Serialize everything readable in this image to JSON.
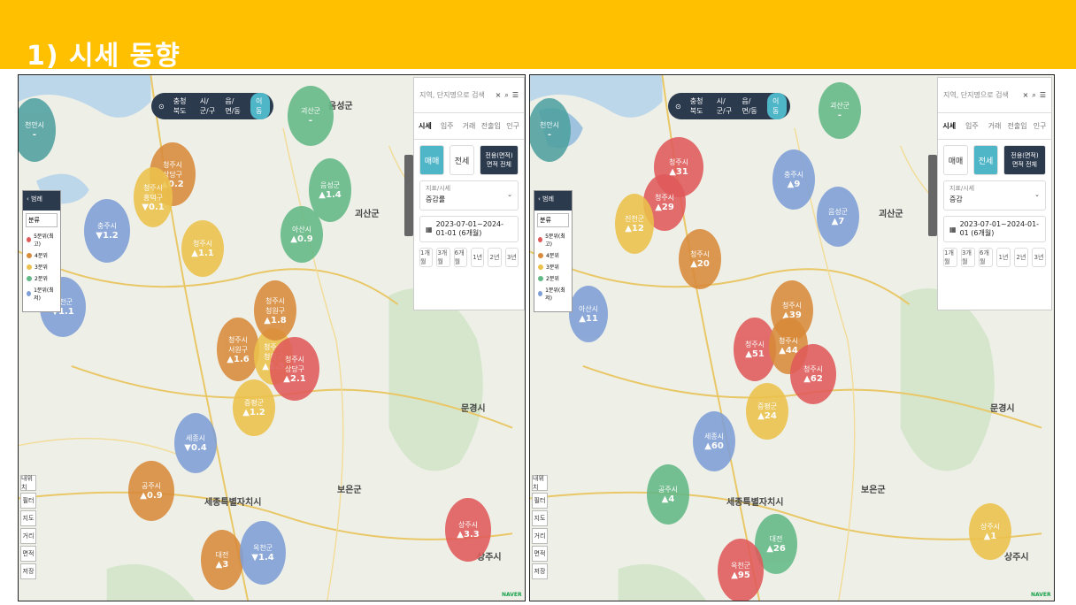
{
  "header": {
    "title": "1) 시세 동향"
  },
  "colors": {
    "header_bg": "#ffc000",
    "red": "#e05a5a",
    "orange": "#d98a3a",
    "yellow": "#ecc24c",
    "green": "#63b986",
    "blue": "#7f9fd6",
    "navy": "#2c3a4e",
    "teal": "#4fb6c8"
  },
  "regions": {
    "goesan": "괴산군",
    "boeun": "보은군",
    "sejong": "세종특별자치시",
    "mungyeong": "문경시",
    "sangju": "상주시",
    "eumseong": "음성군"
  },
  "topbar": {
    "province": "충청북도",
    "city": "시/군/구",
    "town": "읍/면/동",
    "go": "이동"
  },
  "legend": {
    "back_icon": "chevron-left-icon",
    "title": "범례",
    "select": "분류",
    "items": [
      {
        "label": "5분위(최고)",
        "color": "#e05a5a"
      },
      {
        "label": "4분위",
        "color": "#d98a3a"
      },
      {
        "label": "3분위",
        "color": "#ecc24c"
      },
      {
        "label": "2분위",
        "color": "#63b986"
      },
      {
        "label": "1분위(최저)",
        "color": "#7f9fd6"
      }
    ]
  },
  "side_left": {
    "search_placeholder": "지역, 단지명으로 검색",
    "tabs": [
      "시세",
      "입주",
      "거래",
      "전출입",
      "인구"
    ],
    "trade": "매매",
    "rent": "전세",
    "area_top": "전용(면적)",
    "area": "면적 전체",
    "stat_label": "지표/시세",
    "stat_value": "증감률",
    "date": "2023-07-01~2024-01-01 (6개월)",
    "periods": [
      "1개월",
      "3개월",
      "6개월",
      "1년",
      "2년",
      "3년"
    ]
  },
  "side_right": {
    "search_placeholder": "지역, 단지명으로 검색",
    "tabs": [
      "시세",
      "입주",
      "거래",
      "전출입",
      "인구"
    ],
    "trade": "매매",
    "rent": "전세",
    "area_top": "전용(면적)",
    "area": "면적 전체",
    "stat_label": "지표/시세",
    "stat_value": "증감",
    "date": "2023-07-01~2024-01-01 (6개월)",
    "periods": [
      "1개월",
      "3개월",
      "6개월",
      "1년",
      "2년",
      "3년"
    ]
  },
  "tools": [
    "내위치",
    "필터",
    "지도",
    "거리",
    "면적",
    "저장"
  ],
  "logo": "NAVER",
  "bubbles_left": [
    {
      "name": "청주시",
      "val": "▲0.2",
      "sub": "상당구",
      "color": "#d98a3a"
    },
    {
      "name": "청주시",
      "val": "▼0.1",
      "sub": "흥덕구",
      "color": "#ecc24c"
    },
    {
      "name": "청주시",
      "val": "▲1.6",
      "sub": "서원구",
      "color": "#d98a3a"
    },
    {
      "name": "청주시",
      "val": "▲1.5",
      "sub": "청원구",
      "color": "#ecc24c"
    },
    {
      "name": "청주시",
      "val": "▲2.1",
      "sub": "상당구",
      "color": "#e05a5a"
    },
    {
      "name": "청주시",
      "val": "▲1.8",
      "sub": "청원구",
      "color": "#d98a3a"
    },
    {
      "name": "충주시",
      "val": "▼1.2",
      "sub": "",
      "color": "#7f9fd6"
    },
    {
      "name": "진천군",
      "val": "▼1.1",
      "sub": "",
      "color": "#7f9fd6"
    },
    {
      "name": "음성군",
      "val": "▲1.4",
      "sub": "",
      "color": "#63b986"
    },
    {
      "name": "괴산군",
      "val": "-",
      "sub": "",
      "color": "#63b986"
    },
    {
      "name": "세종시",
      "val": "▼0.4",
      "sub": "",
      "color": "#7f9fd6"
    },
    {
      "name": "증평군",
      "val": "▲1.2",
      "sub": "",
      "color": "#ecc24c"
    },
    {
      "name": "공주시",
      "val": "▲0.9",
      "sub": "",
      "color": "#d98a3a"
    },
    {
      "name": "대전",
      "val": "▲3",
      "sub": "",
      "color": "#d98a3a"
    },
    {
      "name": "옥천군",
      "val": "▼1.4",
      "sub": "",
      "color": "#7f9fd6"
    },
    {
      "name": "천안시",
      "val": "-",
      "sub": "",
      "color": "#4fa0a0"
    },
    {
      "name": "아산시",
      "val": "▲0.9",
      "sub": "",
      "color": "#63b986"
    },
    {
      "name": "상주시",
      "val": "▲3.3",
      "sub": "",
      "color": "#e05a5a"
    },
    {
      "name": "청주시",
      "val": "▲1.1",
      "sub": "",
      "color": "#ecc24c"
    }
  ],
  "bubbles_right": [
    {
      "name": "청주시",
      "val": "▲31",
      "sub": "",
      "color": "#e05a5a"
    },
    {
      "name": "청주시",
      "val": "▲29",
      "sub": "",
      "color": "#e05a5a"
    },
    {
      "name": "청주시",
      "val": "▲20",
      "sub": "",
      "color": "#d98a3a"
    },
    {
      "name": "청주시",
      "val": "▲39",
      "sub": "",
      "color": "#d98a3a"
    },
    {
      "name": "청주시",
      "val": "▲51",
      "sub": "",
      "color": "#e05a5a"
    },
    {
      "name": "청주시",
      "val": "▲44",
      "sub": "",
      "color": "#d98a3a"
    },
    {
      "name": "청주시",
      "val": "▲62",
      "sub": "",
      "color": "#e05a5a"
    },
    {
      "name": "진천군",
      "val": "▲12",
      "sub": "",
      "color": "#ecc24c"
    },
    {
      "name": "충주시",
      "val": "▲9",
      "sub": "",
      "color": "#7f9fd6"
    },
    {
      "name": "음성군",
      "val": "▲7",
      "sub": "",
      "color": "#7f9fd6"
    },
    {
      "name": "증평군",
      "val": "▲24",
      "sub": "",
      "color": "#ecc24c"
    },
    {
      "name": "세종시",
      "val": "▲60",
      "sub": "",
      "color": "#7f9fd6"
    },
    {
      "name": "공주시",
      "val": "▲4",
      "sub": "",
      "color": "#63b986"
    },
    {
      "name": "대전",
      "val": "▲26",
      "sub": "",
      "color": "#63b986"
    },
    {
      "name": "옥천군",
      "val": "▲95",
      "sub": "",
      "color": "#e05a5a"
    },
    {
      "name": "천안시",
      "val": "-",
      "sub": "",
      "color": "#4fa0a0"
    },
    {
      "name": "아산시",
      "val": "▲11",
      "sub": "",
      "color": "#7f9fd6"
    },
    {
      "name": "괴산군",
      "val": "-",
      "sub": "",
      "color": "#63b986"
    },
    {
      "name": "상주시",
      "val": "▲1",
      "sub": "",
      "color": "#ecc24c"
    }
  ]
}
